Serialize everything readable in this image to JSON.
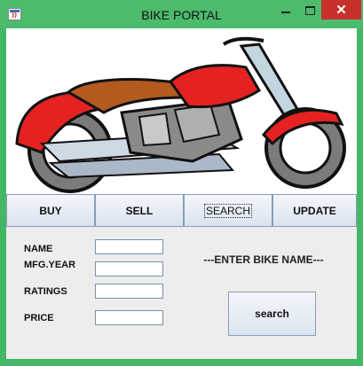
{
  "window": {
    "title": "BIKE PORTAL",
    "close_glyph": "✕"
  },
  "nav": [
    {
      "label": "BUY"
    },
    {
      "label": "SELL"
    },
    {
      "label": "SEARCH"
    },
    {
      "label": "UPDATE"
    }
  ],
  "form": {
    "fields": [
      {
        "label": "NAME",
        "value": ""
      },
      {
        "label": "MFG.YEAR",
        "value": ""
      },
      {
        "label": "RATINGS",
        "value": ""
      },
      {
        "label": "PRICE",
        "value": ""
      }
    ],
    "hint": "---ENTER BIKE NAME---",
    "search_label": "search"
  },
  "image": {
    "subject": "motorcycle-illustration",
    "body_color": "#e52222",
    "seat_color": "#b35a1f"
  }
}
